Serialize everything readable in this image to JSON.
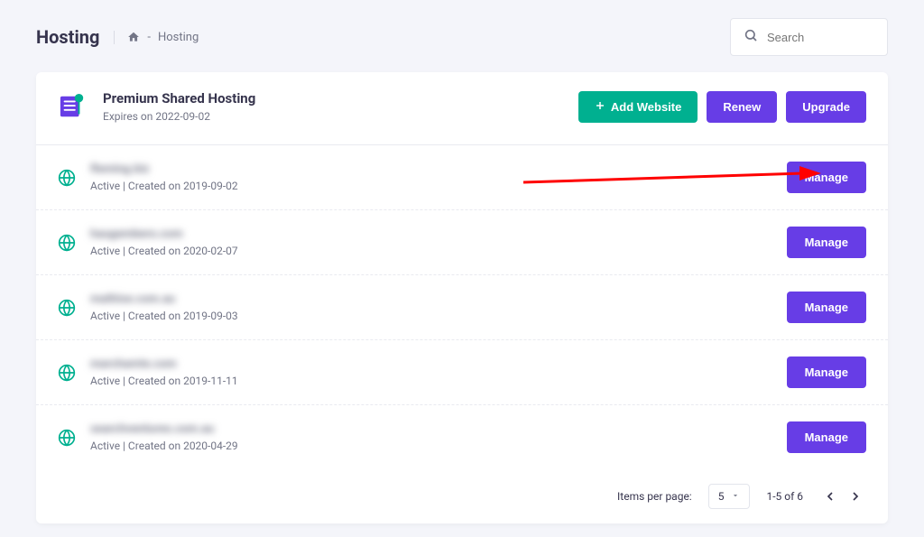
{
  "header": {
    "title": "Hosting",
    "breadcrumb_separator": "-",
    "breadcrumb_current": "Hosting",
    "search_placeholder": "Search"
  },
  "plan": {
    "name": "Premium Shared Hosting",
    "expiry": "Expires on 2022-09-02",
    "add_website_label": "Add Website",
    "renew_label": "Renew",
    "upgrade_label": "Upgrade"
  },
  "sites": [
    {
      "domain": "fleming.biz",
      "status": "Active | Created on 2019-09-02",
      "manage_label": "Manage",
      "highlighted": true
    },
    {
      "domain": "haugembero.com",
      "status": "Active | Created on 2020-02-07",
      "manage_label": "Manage",
      "highlighted": false
    },
    {
      "domain": "mathise.com.au",
      "status": "Active | Created on 2019-09-03",
      "manage_label": "Manage",
      "highlighted": false
    },
    {
      "domain": "marchamte.com",
      "status": "Active | Created on 2019-11-11",
      "manage_label": "Manage",
      "highlighted": false
    },
    {
      "domain": "searchventures.com.au",
      "status": "Active | Created on 2020-04-29",
      "manage_label": "Manage",
      "highlighted": false
    }
  ],
  "pagination": {
    "items_per_page_label": "Items per page:",
    "page_size": "5",
    "range_label": "1-5 of 6"
  }
}
